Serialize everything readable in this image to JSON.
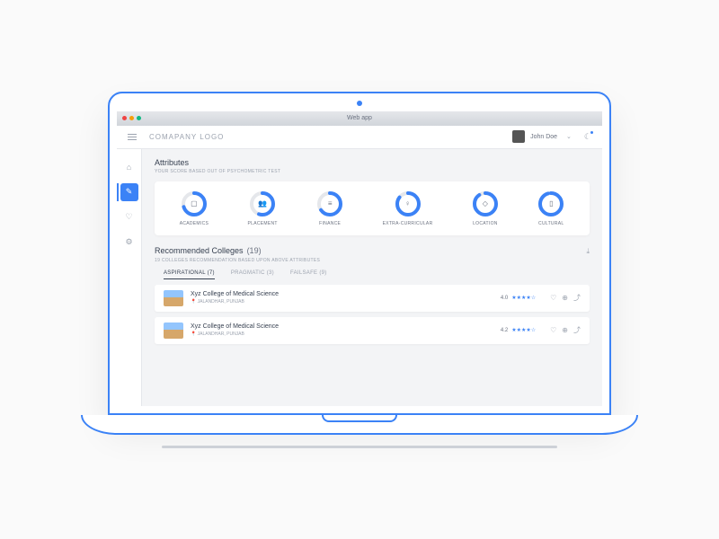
{
  "titlebar": {
    "title": "Web app"
  },
  "header": {
    "logo": "COMAPANY LOGO",
    "username": "John Doe"
  },
  "sidebar": {
    "items": [
      {
        "icon": "⌂",
        "name": "home"
      },
      {
        "icon": "✎",
        "name": "attributes",
        "active": true
      },
      {
        "icon": "♡",
        "name": "favorites"
      },
      {
        "icon": "⚙",
        "name": "settings"
      }
    ]
  },
  "attributes": {
    "title": "Attributes",
    "subtitle": "YOUR SCORE BASED OUT OF PSYCHOMETRIC TEST",
    "items": [
      {
        "label": "ACADEMICS",
        "icon": "▢",
        "pct": 70
      },
      {
        "label": "PLACEMENT",
        "icon": "👥",
        "pct": 55
      },
      {
        "label": "FINANCE",
        "icon": "≡",
        "pct": 65
      },
      {
        "label": "EXTRA-CURRICULAR",
        "icon": "♀",
        "pct": 85
      },
      {
        "label": "LOCATION",
        "icon": "◇",
        "pct": 90
      },
      {
        "label": "CULTURAL",
        "icon": "▯",
        "pct": 95
      }
    ]
  },
  "recommended": {
    "title": "Recommended Colleges",
    "count": "(19)",
    "subtitle": "19 COLLEGES RECOMMENDATION BASED UPON ABOVE ATTRIBUTES",
    "tabs": [
      {
        "label": "ASPIRATIONAL",
        "count": "(7)",
        "active": true
      },
      {
        "label": "PRAGMATIC",
        "count": "(3)"
      },
      {
        "label": "FAILSAFE",
        "count": "(9)"
      }
    ],
    "colleges": [
      {
        "name": "Xyz College of Medical Science",
        "location": "JALANDHAR, PUNJAB",
        "rating": "4.0",
        "stars": "★★★★☆"
      },
      {
        "name": "Xyz College of Medical Science",
        "location": "JALANDHAR, PUNJAB",
        "rating": "4.2",
        "stars": "★★★★☆"
      }
    ]
  }
}
